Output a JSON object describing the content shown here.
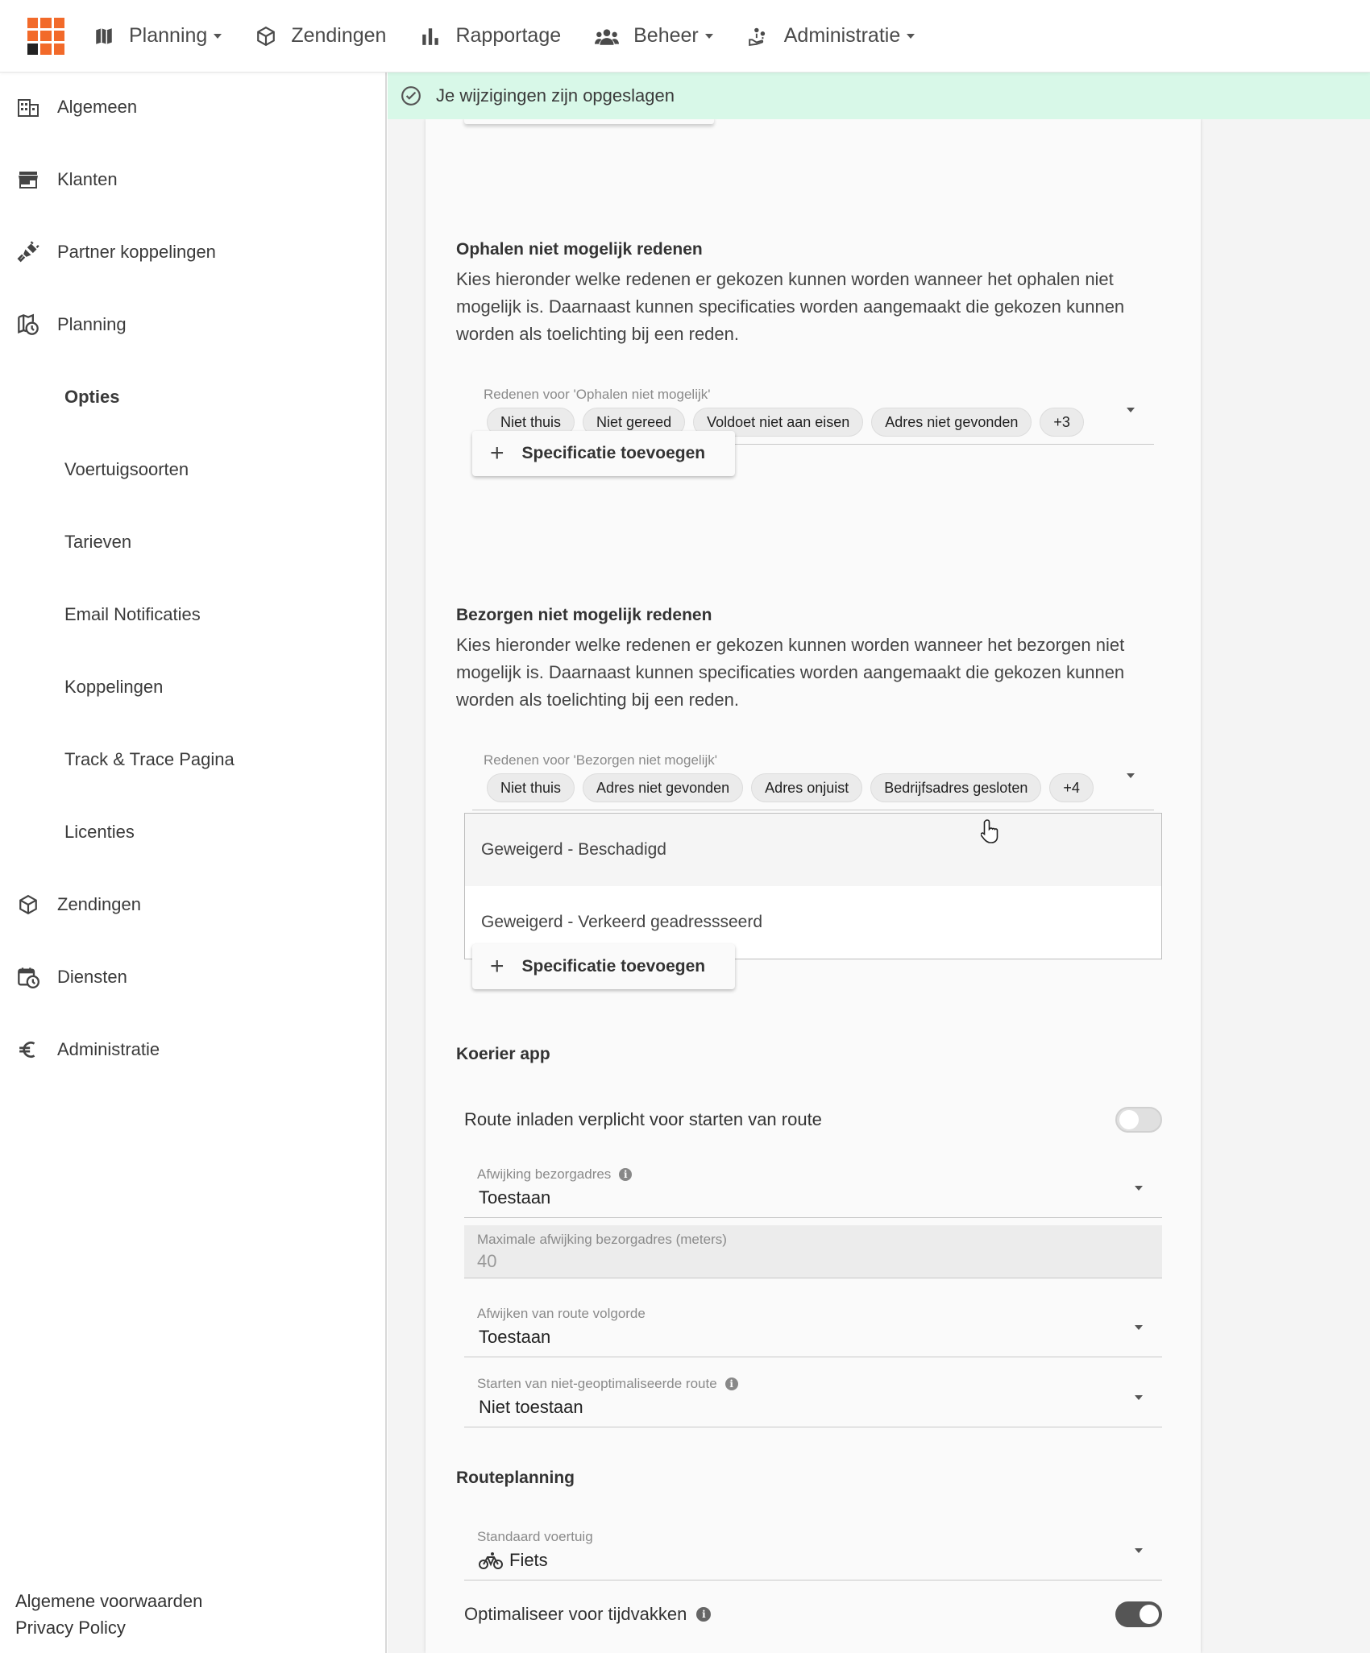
{
  "topnav": {
    "items": [
      {
        "label": "Planning",
        "icon": "map-icon",
        "dropdown": true
      },
      {
        "label": "Zendingen",
        "icon": "box-icon",
        "dropdown": false
      },
      {
        "label": "Rapportage",
        "icon": "bar-chart-icon",
        "dropdown": false
      },
      {
        "label": "Beheer",
        "icon": "users-icon",
        "dropdown": true
      },
      {
        "label": "Administratie",
        "icon": "hand-coins-icon",
        "dropdown": true
      }
    ]
  },
  "sidebar": {
    "items": [
      {
        "label": "Algemeen",
        "icon": "building-icon"
      },
      {
        "label": "Klanten",
        "icon": "store-icon"
      },
      {
        "label": "Partner koppelingen",
        "icon": "plug-icon"
      },
      {
        "label": "Planning",
        "icon": "map-clock-icon"
      },
      {
        "label": "Opties",
        "sub": true,
        "active": true
      },
      {
        "label": "Voertuigsoorten",
        "sub": true
      },
      {
        "label": "Tarieven",
        "sub": true
      },
      {
        "label": "Email Notificaties",
        "sub": true
      },
      {
        "label": "Koppelingen",
        "sub": true
      },
      {
        "label": "Track & Trace Pagina",
        "sub": true
      },
      {
        "label": "Licenties",
        "sub": true
      },
      {
        "label": "Zendingen",
        "icon": "box-icon"
      },
      {
        "label": "Diensten",
        "icon": "calendar-clock-icon"
      },
      {
        "label": "Administratie",
        "icon": "euro-icon"
      }
    ],
    "footer": {
      "terms": "Algemene voorwaarden",
      "privacy": "Privacy Policy"
    }
  },
  "toast": {
    "message": "Je wijzigingen zijn opgeslagen",
    "icon": "check-circle-icon",
    "color": "#d8f8e8"
  },
  "pickup": {
    "heading": "Ophalen niet mogelijk redenen",
    "description": "Kies hieronder welke redenen er gekozen kunnen worden wanneer het ophalen niet mogelijk is. Daarnaast kunnen specificaties worden aangemaakt die gekozen kunnen worden als toelichting bij een reden.",
    "field_label": "Redenen voor 'Ophalen niet mogelijk'",
    "chips": [
      "Niet thuis",
      "Niet gereed",
      "Voldoet niet aan eisen",
      "Adres niet gevonden",
      "+3"
    ],
    "add_button": "Specificatie toevoegen"
  },
  "delivery": {
    "heading": "Bezorgen niet mogelijk redenen",
    "description": "Kies hieronder welke redenen er gekozen kunnen worden wanneer het bezorgen niet mogelijk is. Daarnaast kunnen specificaties worden aangemaakt die gekozen kunnen worden als toelichting bij een reden.",
    "field_label": "Redenen voor 'Bezorgen niet mogelijk'",
    "chips": [
      "Niet thuis",
      "Adres niet gevonden",
      "Adres onjuist",
      "Bedrijfsadres gesloten",
      "+4"
    ],
    "specifications": [
      "Geweigerd - Beschadigd",
      "Geweigerd - Verkeerd geadressseerd"
    ],
    "add_button": "Specificatie toevoegen"
  },
  "courier_app": {
    "heading": "Koerier app",
    "route_load_label": "Route inladen verplicht voor starten van route",
    "route_load_on": false,
    "deviation_address": {
      "label": "Afwijking bezorgadres",
      "value": "Toestaan"
    },
    "max_deviation": {
      "label": "Maximale afwijking bezorgadres (meters)",
      "value": "40"
    },
    "route_order": {
      "label": "Afwijken van route volgorde",
      "value": "Toestaan"
    },
    "unoptimized": {
      "label": "Starten van niet-geoptimaliseerde route",
      "value": "Niet toestaan"
    }
  },
  "routeplanning": {
    "heading": "Routeplanning",
    "default_vehicle": {
      "label": "Standaard voertuig",
      "value": "Fiets",
      "icon": "bicycle-icon"
    },
    "optimize_label": "Optimaliseer voor tijdvakken",
    "optimize_on": true
  },
  "colors": {
    "brand": "#f26a2a",
    "toggle_on": "#555555",
    "toggle_off": "#e0e0e0"
  }
}
